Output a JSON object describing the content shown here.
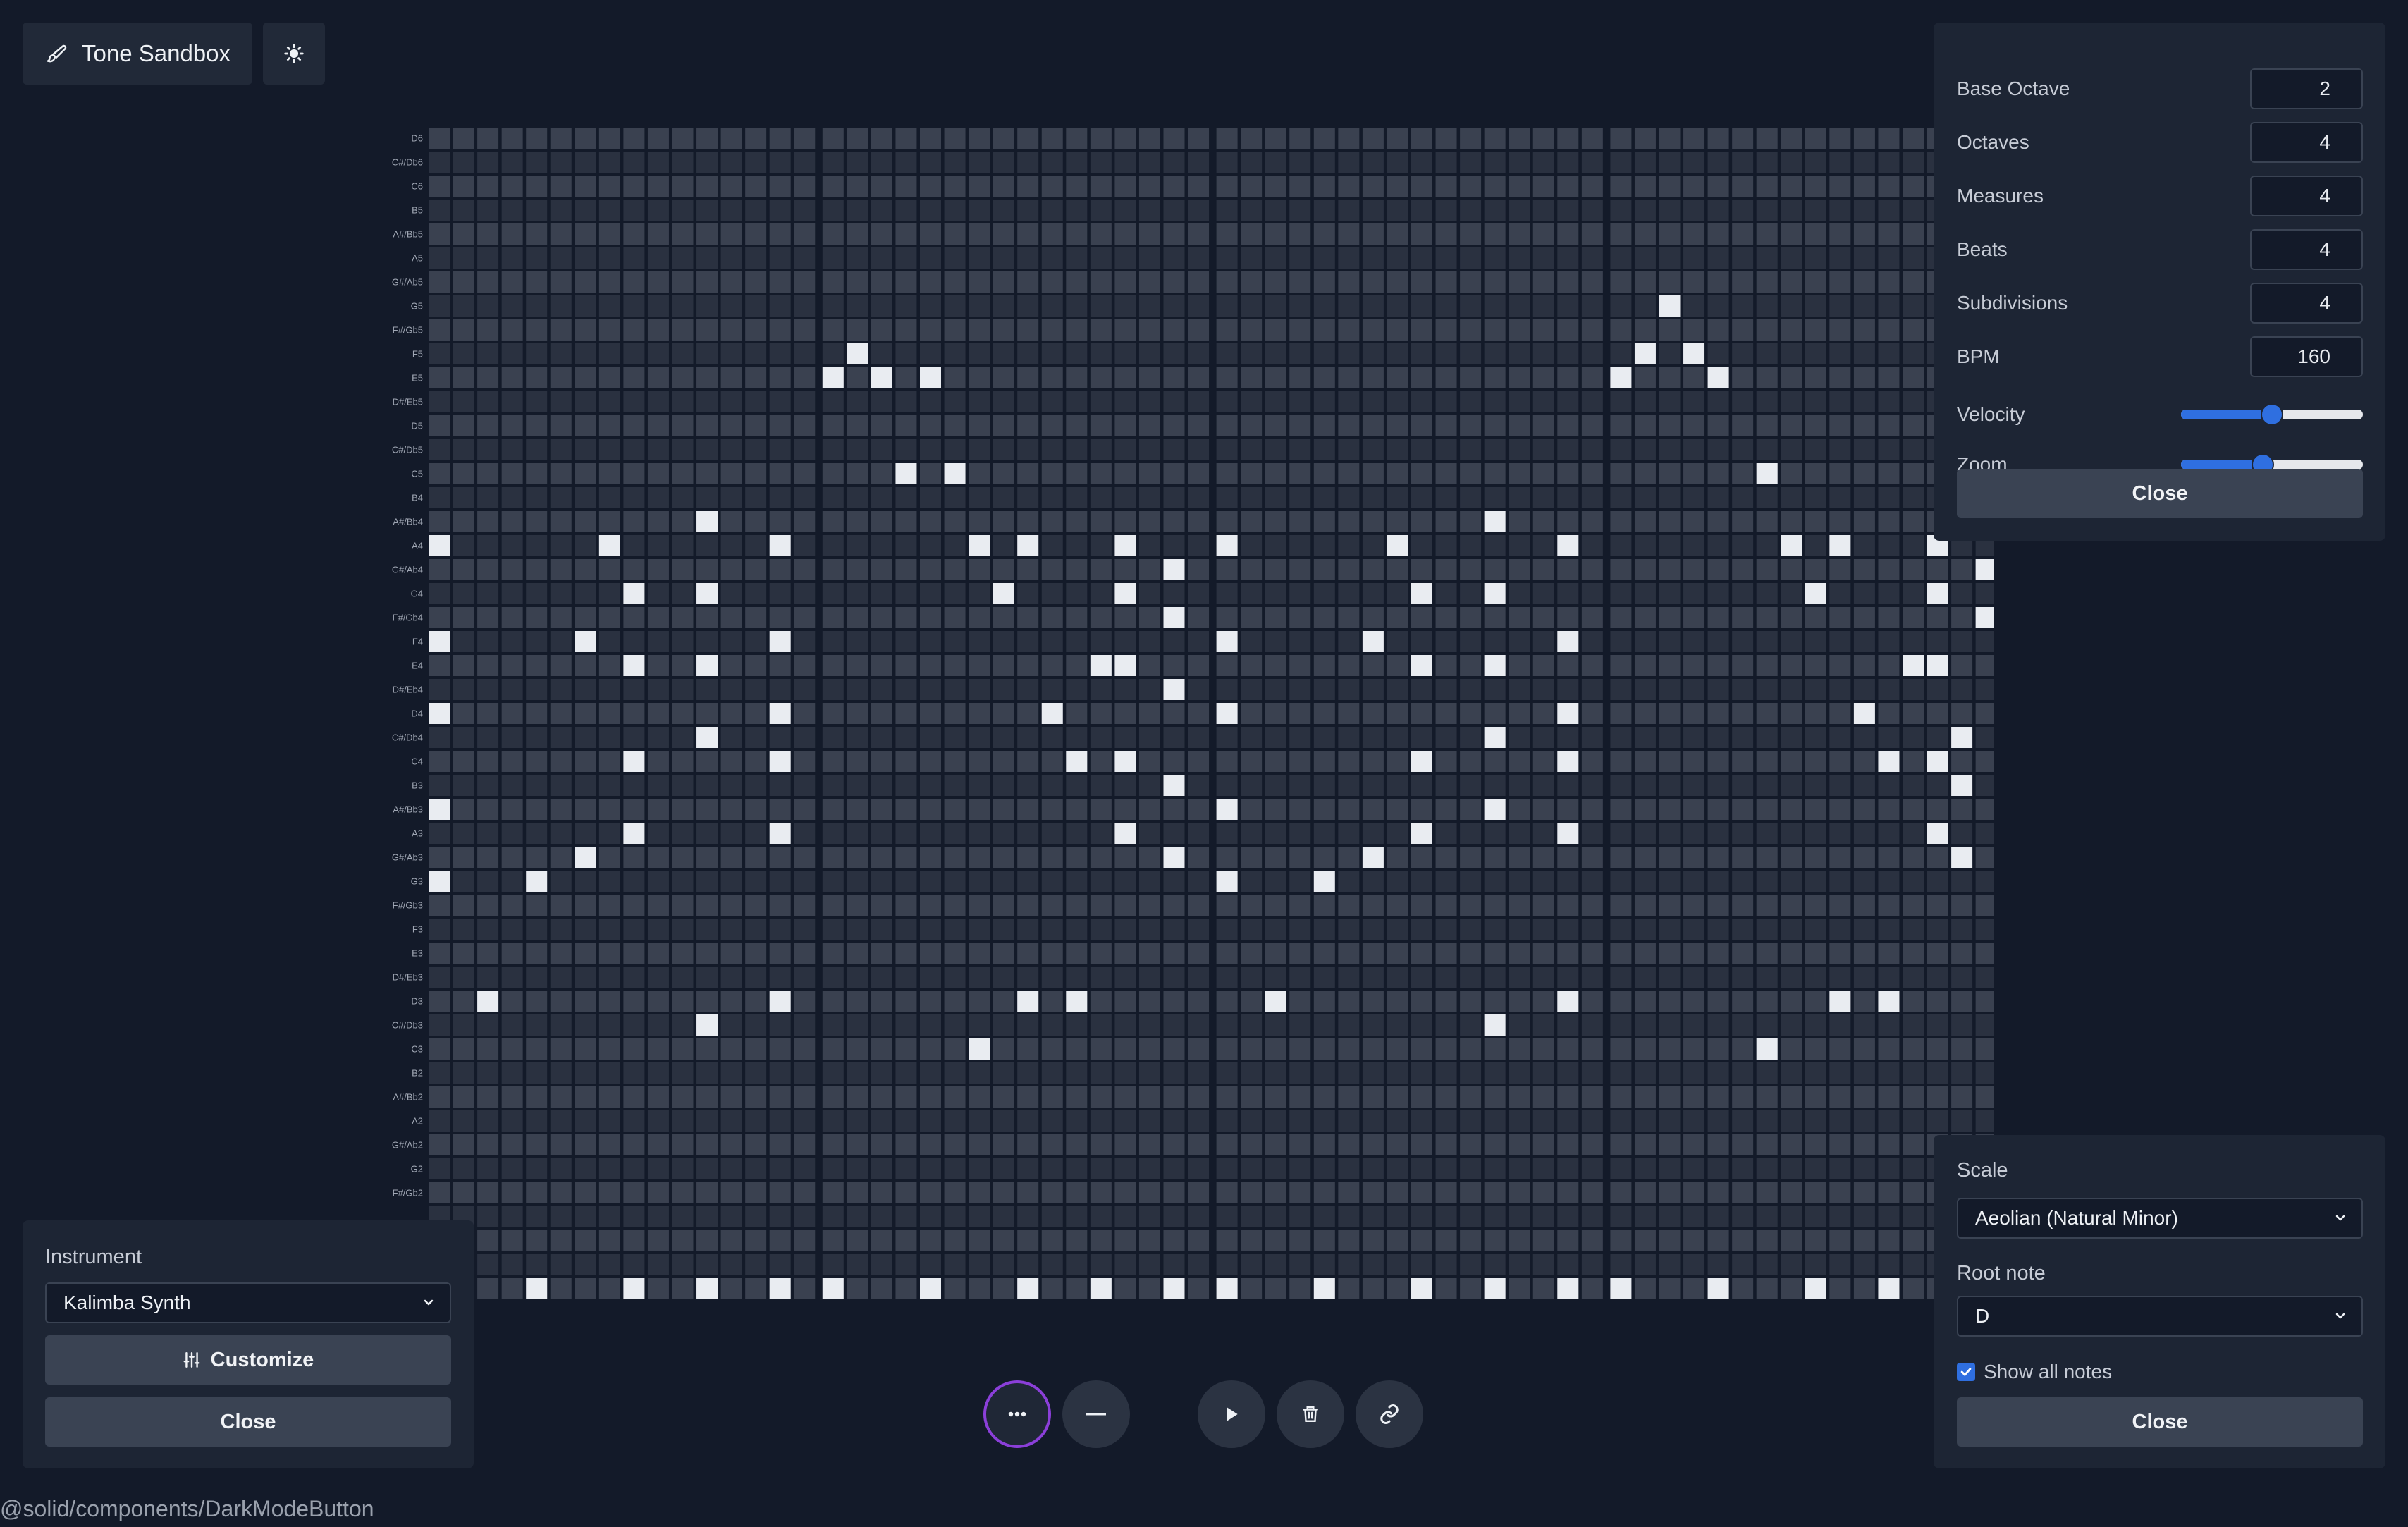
{
  "header": {
    "title": "Tone Sandbox",
    "title_icon": "paintbrush-icon",
    "dark_mode_icon": "sun-icon"
  },
  "grid": {
    "note_labels": [
      "D6",
      "C#/Db6",
      "C6",
      "B5",
      "A#/Bb5",
      "A5",
      "G#/Ab5",
      "G5",
      "F#/Gb5",
      "F5",
      "E5",
      "D#/Eb5",
      "D5",
      "C#/Db5",
      "C5",
      "B4",
      "A#/Bb4",
      "A4",
      "G#/Ab4",
      "G4",
      "F#/Gb4",
      "F4",
      "E4",
      "D#/Eb4",
      "D4",
      "C#/Db4",
      "C4",
      "B3",
      "A#/Bb3",
      "A3",
      "G#/Ab3",
      "G3",
      "F#/Gb3",
      "F3",
      "E3",
      "D#/Eb3",
      "D3",
      "C#/Db3",
      "C3",
      "B2",
      "A#/Bb2",
      "A2",
      "G#/Ab2",
      "G2",
      "F#/Gb2"
    ],
    "measures": 4,
    "steps_per_measure": 16,
    "extra_steps": 2,
    "active_notes": [
      [
        10,
        16
      ],
      [
        9,
        17
      ],
      [
        10,
        18
      ],
      [
        10,
        20
      ],
      [
        7,
        50
      ],
      [
        9,
        49
      ],
      [
        9,
        51
      ],
      [
        10,
        48
      ],
      [
        10,
        52
      ],
      [
        14,
        19
      ],
      [
        14,
        21
      ],
      [
        14,
        54
      ],
      [
        16,
        11
      ],
      [
        16,
        43
      ],
      [
        17,
        0
      ],
      [
        17,
        7
      ],
      [
        17,
        14
      ],
      [
        17,
        22
      ],
      [
        17,
        24
      ],
      [
        17,
        28
      ],
      [
        17,
        32
      ],
      [
        17,
        39
      ],
      [
        17,
        46
      ],
      [
        17,
        55
      ],
      [
        17,
        57
      ],
      [
        17,
        61
      ],
      [
        18,
        30
      ],
      [
        18,
        63
      ],
      [
        19,
        8
      ],
      [
        19,
        11
      ],
      [
        19,
        23
      ],
      [
        19,
        28
      ],
      [
        19,
        40
      ],
      [
        19,
        43
      ],
      [
        19,
        56
      ],
      [
        19,
        61
      ],
      [
        20,
        30
      ],
      [
        20,
        63
      ],
      [
        21,
        0
      ],
      [
        21,
        6
      ],
      [
        21,
        14
      ],
      [
        21,
        32
      ],
      [
        21,
        38
      ],
      [
        21,
        46
      ],
      [
        22,
        8
      ],
      [
        22,
        11
      ],
      [
        22,
        27
      ],
      [
        22,
        28
      ],
      [
        22,
        40
      ],
      [
        22,
        43
      ],
      [
        22,
        60
      ],
      [
        22,
        61
      ],
      [
        23,
        30
      ],
      [
        24,
        0
      ],
      [
        24,
        14
      ],
      [
        24,
        25
      ],
      [
        24,
        32
      ],
      [
        24,
        46
      ],
      [
        24,
        58
      ],
      [
        25,
        11
      ],
      [
        25,
        43
      ],
      [
        25,
        62
      ],
      [
        26,
        8
      ],
      [
        26,
        14
      ],
      [
        26,
        26
      ],
      [
        26,
        28
      ],
      [
        26,
        40
      ],
      [
        26,
        46
      ],
      [
        26,
        59
      ],
      [
        26,
        61
      ],
      [
        27,
        30
      ],
      [
        27,
        62
      ],
      [
        28,
        0
      ],
      [
        28,
        32
      ],
      [
        28,
        43
      ],
      [
        29,
        8
      ],
      [
        29,
        14
      ],
      [
        29,
        28
      ],
      [
        29,
        40
      ],
      [
        29,
        46
      ],
      [
        29,
        61
      ],
      [
        30,
        6
      ],
      [
        30,
        30
      ],
      [
        30,
        38
      ],
      [
        30,
        62
      ],
      [
        31,
        0
      ],
      [
        31,
        4
      ],
      [
        31,
        32
      ],
      [
        31,
        36
      ],
      [
        36,
        2
      ],
      [
        36,
        14
      ],
      [
        36,
        24
      ],
      [
        36,
        26
      ],
      [
        36,
        34
      ],
      [
        36,
        46
      ],
      [
        36,
        57
      ],
      [
        36,
        59
      ],
      [
        37,
        11
      ],
      [
        37,
        43
      ],
      [
        38,
        22
      ],
      [
        38,
        54
      ],
      [
        48,
        4
      ],
      [
        48,
        8
      ],
      [
        48,
        11
      ],
      [
        48,
        14
      ],
      [
        48,
        16
      ],
      [
        48,
        20
      ],
      [
        48,
        24
      ],
      [
        48,
        27
      ],
      [
        48,
        30
      ],
      [
        48,
        32
      ],
      [
        48,
        36
      ],
      [
        48,
        40
      ],
      [
        48,
        43
      ],
      [
        48,
        46
      ],
      [
        48,
        48
      ],
      [
        48,
        52
      ],
      [
        48,
        56
      ],
      [
        48,
        59
      ],
      [
        48,
        62
      ]
    ]
  },
  "settings": {
    "fields": [
      {
        "label": "Base Octave",
        "value": "2"
      },
      {
        "label": "Octaves",
        "value": "4"
      },
      {
        "label": "Measures",
        "value": "4"
      },
      {
        "label": "Beats",
        "value": "4"
      },
      {
        "label": "Subdivisions",
        "value": "4"
      },
      {
        "label": "BPM",
        "value": "160"
      }
    ],
    "velocity_label": "Velocity",
    "velocity_level": 0.5,
    "zoom_label": "Zoom",
    "zoom_level": 0.45,
    "close_label": "Close"
  },
  "scale_panel": {
    "scale_label": "Scale",
    "scale_value": "Aeolian (Natural Minor)",
    "root_label": "Root note",
    "root_value": "D",
    "show_all_label": "Show all notes",
    "show_all_checked": true,
    "close_label": "Close"
  },
  "instrument_panel": {
    "label": "Instrument",
    "value": "Kalimba Synth",
    "customize_label": "Customize",
    "close_label": "Close"
  },
  "controls": [
    "more-icon",
    "minus-icon",
    "play-icon",
    "trash-icon",
    "link-icon"
  ],
  "footer": {
    "text": "@solid/components/DarkModeButton"
  },
  "colors": {
    "background": "#131a29",
    "cell_light": "#3a4150",
    "cell_dark": "#2a3140",
    "note_active": "#e9ecf1",
    "accent": "#2f6fe0",
    "active_ring": "#8b3fd9"
  }
}
